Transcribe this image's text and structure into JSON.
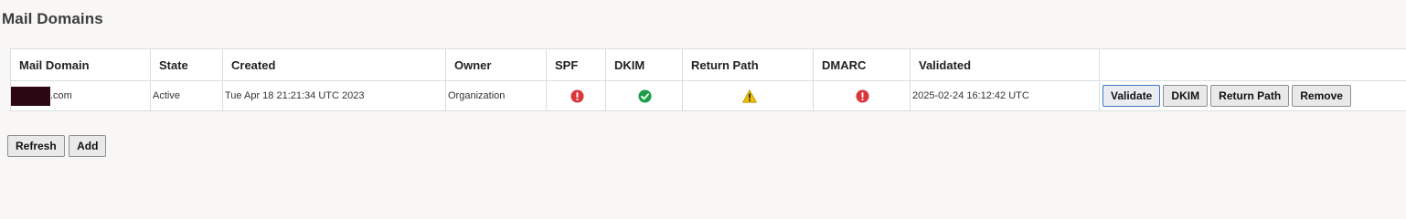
{
  "page": {
    "title": "Mail Domains"
  },
  "table": {
    "columns": [
      "Mail Domain",
      "State",
      "Created",
      "Owner",
      "SPF",
      "DKIM",
      "Return Path",
      "DMARC",
      "Validated",
      ""
    ],
    "rows": [
      {
        "domain_suffix": ".com",
        "state": "Active",
        "created": "Tue Apr 18 21:21:34 UTC 2023",
        "owner": "Organization",
        "spf": "error",
        "dkim": "ok",
        "return_path": "warning",
        "dmarc": "error",
        "validated": "2025-02-24 16:12:42 UTC",
        "actions": {
          "validate": "Validate",
          "dkim": "DKIM",
          "return_path": "Return Path",
          "remove": "Remove"
        }
      }
    ]
  },
  "buttons": {
    "refresh": "Refresh",
    "add": "Add"
  },
  "colors": {
    "error": "#d9363e",
    "ok": "#1a9e48",
    "warning": "#f2c200",
    "primary_border": "#3a78c2"
  }
}
